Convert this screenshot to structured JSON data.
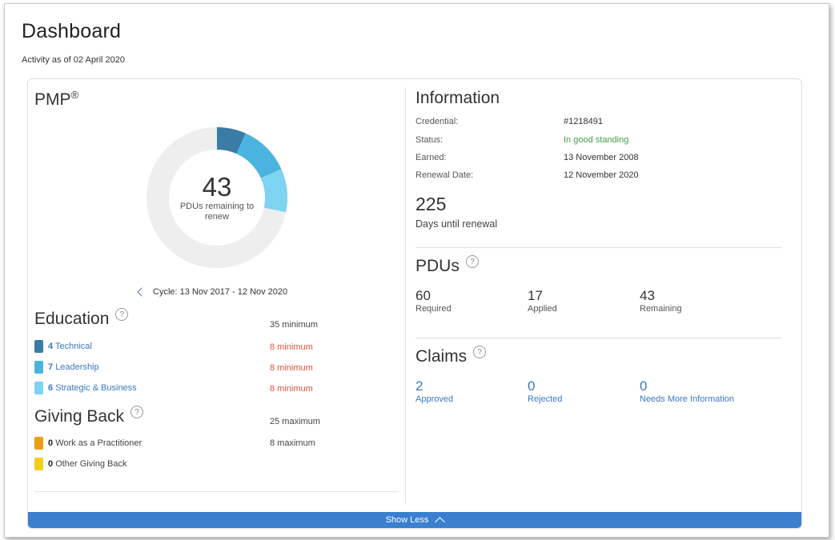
{
  "page": {
    "title": "Dashboard",
    "subtitle": "Activity as of 02 April 2020"
  },
  "certification": {
    "name": "PMP",
    "mark": "®",
    "pdus_remaining": "43",
    "pdus_remaining_label": "PDUs remaining to renew",
    "cycle": "Cycle: 13 Nov 2017 - 12 Nov 2020",
    "donut_colors": [
      "#3a7ca6",
      "#4bb3e0",
      "#7dd3f0"
    ],
    "donut_track_color": "#eeeeee"
  },
  "education": {
    "title": "Education",
    "limit": "35 minimum",
    "items": [
      {
        "count": "4",
        "label": "Technical",
        "limit": "8 minimum",
        "color": "#3a7ca6"
      },
      {
        "count": "7",
        "label": "Leadership",
        "limit": "8 minimum",
        "color": "#4bb3e0"
      },
      {
        "count": "6",
        "label": "Strategic & Business",
        "limit": "8 minimum",
        "color": "#7dd3f0"
      }
    ]
  },
  "giving_back": {
    "title": "Giving Back",
    "limit": "25 maximum",
    "items": [
      {
        "count": "0",
        "label": "Work as a Practitioner",
        "limit": "8 maximum",
        "color": "#e8a012"
      },
      {
        "count": "0",
        "label": "Other Giving Back",
        "limit": "",
        "color": "#f2cf1c"
      }
    ]
  },
  "information": {
    "title": "Information",
    "rows": [
      {
        "label": "Credential:",
        "value": "#1218491"
      },
      {
        "label": "Status:",
        "value": "In good standing"
      },
      {
        "label": "Earned:",
        "value": "13 November 2008"
      },
      {
        "label": "Renewal Date:",
        "value": "12 November 2020"
      }
    ],
    "days_until_renewal": "225",
    "days_label": "Days until renewal"
  },
  "pdus": {
    "title": "PDUs",
    "stats": [
      {
        "value": "60",
        "label": "Required"
      },
      {
        "value": "17",
        "label": "Applied"
      },
      {
        "value": "43",
        "label": "Remaining"
      }
    ]
  },
  "claims": {
    "title": "Claims",
    "stats": [
      {
        "value": "2",
        "label": "Approved"
      },
      {
        "value": "0",
        "label": "Rejected"
      },
      {
        "value": "0",
        "label": "Needs More Information"
      }
    ]
  },
  "footer": {
    "show_less_label": "Show Less"
  },
  "colors": {
    "accent_blue": "#3a7fd0",
    "link_blue": "#3a78c2",
    "warning_red": "#e0523a",
    "success_green": "#44a047"
  }
}
